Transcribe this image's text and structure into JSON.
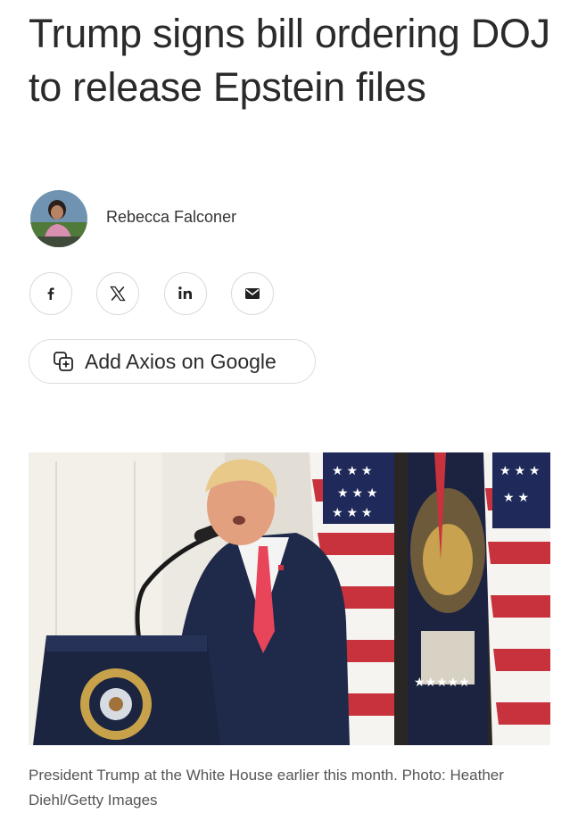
{
  "article": {
    "headline": "Trump signs bill ordering DOJ to release Epstein files",
    "author": {
      "name": "Rebecca Falconer",
      "avatar_icon": "author-photo"
    },
    "share": [
      {
        "network": "facebook",
        "icon": "facebook-icon",
        "glyph": "f"
      },
      {
        "network": "x",
        "icon": "x-icon",
        "glyph": "𝕏"
      },
      {
        "network": "linkedin",
        "icon": "linkedin-icon",
        "glyph": "in"
      },
      {
        "network": "email",
        "icon": "email-icon",
        "glyph": "✉"
      }
    ],
    "google_button": {
      "label": "Add Axios on Google",
      "icon": "add-source-icon"
    },
    "image": {
      "caption": "President Trump at the White House earlier this month. Photo: Heather Diehl/Getty Images"
    }
  },
  "colors": {
    "text": "#2a2a2a",
    "caption": "#555555",
    "border": "#d9d9d9",
    "tie": "#e8455a",
    "flag_red": "#c8323c",
    "flag_blue": "#1f2a5a"
  }
}
